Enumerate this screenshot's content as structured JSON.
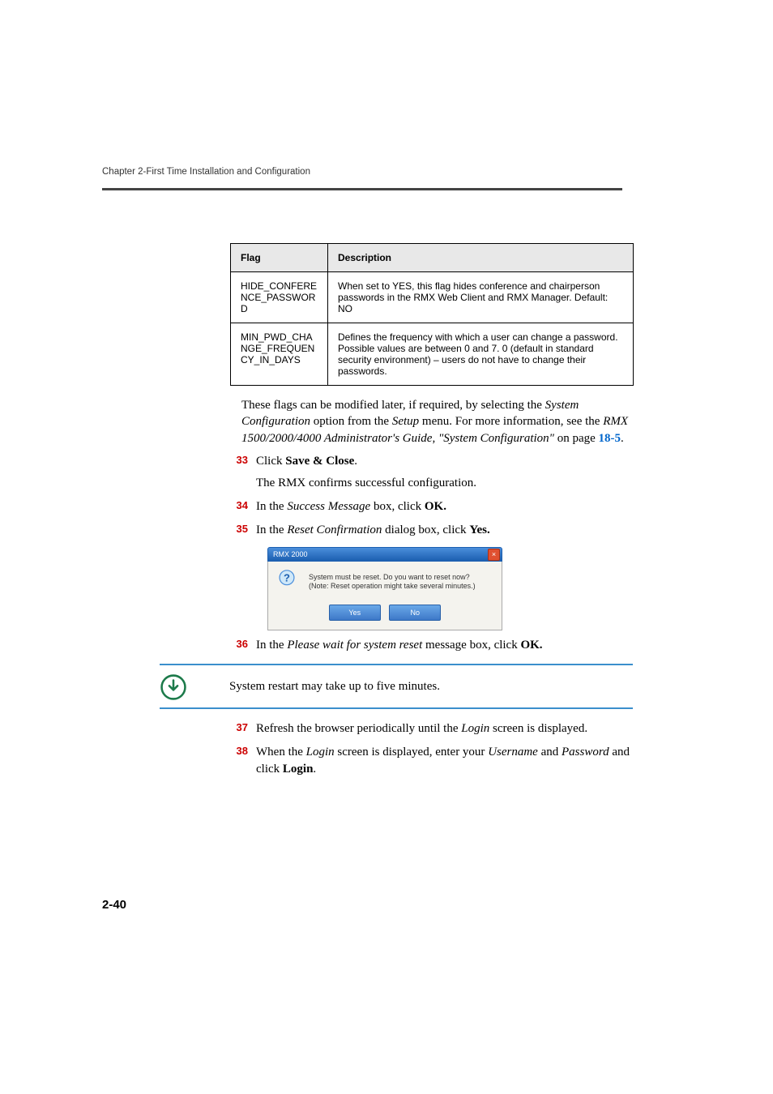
{
  "header": {
    "running_head": "Chapter 2-First Time Installation and Configuration"
  },
  "table": {
    "col1_header": "Flag",
    "col2_header": "Description",
    "rows": [
      {
        "flag": "HIDE_CONFERENCE_PASSWORD",
        "desc": "When set to YES, this flag hides conference and chairperson passwords in the RMX Web Client and RMX Manager. Default: NO"
      },
      {
        "flag": "MIN_PWD_CHANGE_FREQUENCY_IN_DAYS",
        "desc": "Defines the frequency with which a user can change a password. Possible values are between 0 and 7. 0 (default in standard security environment) – users do not have to change their passwords."
      }
    ]
  },
  "body": {
    "p1_a": "These flags can be modified later, if required, by selecting the ",
    "p1_b": "System Configuration",
    "p1_c": " option from the ",
    "p1_d": "Setup",
    "p1_e": " menu. For more information, see the ",
    "p1_f": "RMX 1500/2000/4000 Administrator's Guide, \"System Configuration\"",
    "p1_g": " on page ",
    "p1_link": "18-5",
    "p1_h": "."
  },
  "steps": {
    "s33_num": "33",
    "s33_a": "Click ",
    "s33_b": "Save & Close",
    "s33_c": ".",
    "s33_sub": "The RMX confirms successful configuration.",
    "s34_num": "34",
    "s34_a": "In the ",
    "s34_b": "Success Message",
    "s34_c": " box, click ",
    "s34_d": "OK.",
    "s35_num": "35",
    "s35_a": "In the ",
    "s35_b": "Reset Confirmation",
    "s35_c": " dialog box, click ",
    "s35_d": "Yes.",
    "s36_num": "36",
    "s36_a": "In the ",
    "s36_b": "Please wait for system reset",
    "s36_c": " message box, click ",
    "s36_d": "OK.",
    "s37_num": "37",
    "s37_a": "Refresh the browser periodically until the ",
    "s37_b": "Login",
    "s37_c": " screen is displayed.",
    "s38_num": "38",
    "s38_a": "When the ",
    "s38_b": "Login",
    "s38_c": " screen is displayed, enter your ",
    "s38_d": "Username",
    "s38_e": " and ",
    "s38_f": "Password",
    "s38_g": " and click ",
    "s38_h": "Login",
    "s38_i": "."
  },
  "dialog": {
    "title": "RMX 2000",
    "line1": "System must be reset. Do you want to reset now?",
    "line2": "(Note: Reset operation might take several minutes.)",
    "yes": "Yes",
    "no": "No"
  },
  "note": {
    "text": "System restart may take up to five minutes."
  },
  "page_number": "2-40"
}
